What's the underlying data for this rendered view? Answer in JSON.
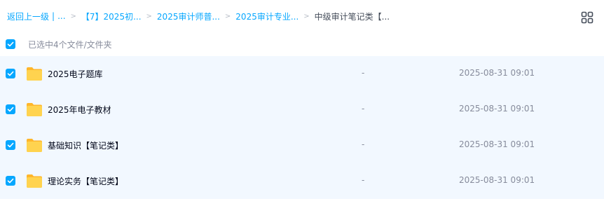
{
  "breadcrumb": {
    "back": "返回上一级",
    "back_sep": "|",
    "back_more": "...",
    "items": [
      "【7】2025初...",
      "2025审计师普...",
      "2025审计专业..."
    ],
    "current": "中级审计笔记类【..."
  },
  "toolbar": {
    "view_toggle_icon": "grid-view-icon"
  },
  "selection": {
    "label": "已选中4个文件/文件夹",
    "all_checked": true
  },
  "colors": {
    "accent": "#06a7ff",
    "row_selected_bg": "#f2f8ff",
    "folder_yellow": "#ffc93b",
    "text_primary": "#03081a",
    "text_secondary": "#878c9c"
  },
  "files": [
    {
      "name": "2025电子题库",
      "size": "-",
      "modified": "2025-08-31 09:01",
      "checked": true,
      "icon": "folder-icon"
    },
    {
      "name": "2025年电子教材",
      "size": "-",
      "modified": "2025-08-31 09:01",
      "checked": true,
      "icon": "folder-icon"
    },
    {
      "name": "基础知识【笔记类】",
      "size": "-",
      "modified": "2025-08-31 09:01",
      "checked": true,
      "icon": "folder-icon"
    },
    {
      "name": "理论实务【笔记类】",
      "size": "-",
      "modified": "2025-08-31 09:01",
      "checked": true,
      "icon": "folder-icon"
    }
  ]
}
